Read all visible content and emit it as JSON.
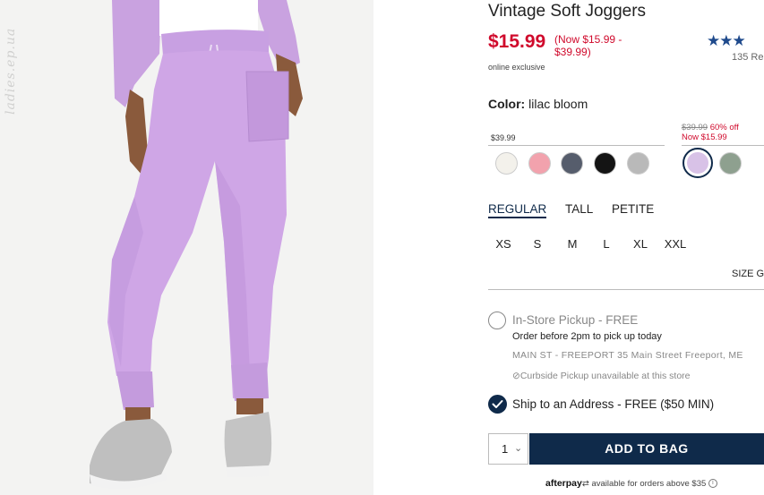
{
  "watermark": "ladies.ep.ua",
  "product": {
    "title": "Vintage Soft Joggers",
    "sale_price": "$15.99",
    "price_range": "(Now $15.99 - $39.99)",
    "exclusive": "online exclusive",
    "rating_value": 3.5,
    "stars": "★★★",
    "reviews": "135 Re"
  },
  "color": {
    "label": "Color:",
    "value": "lilac bloom",
    "regular_group_price": "$39.99",
    "sale_group_was": "$39.99",
    "sale_group_discount": "60% off",
    "sale_group_now": "Now $15.99",
    "swatches": [
      {
        "name": "ivory",
        "hex": "#f3f1eb"
      },
      {
        "name": "pink",
        "hex": "#f2a2ad"
      },
      {
        "name": "slate",
        "hex": "#565d6c"
      },
      {
        "name": "black",
        "hex": "#141414"
      },
      {
        "name": "heather-grey",
        "hex": "#b9b9b9"
      },
      {
        "name": "lilac-bloom",
        "hex": "#d8c2e7",
        "selected": true
      },
      {
        "name": "sage",
        "hex": "#8ea08f"
      }
    ]
  },
  "fit_tabs": [
    {
      "label": "REGULAR",
      "active": true
    },
    {
      "label": "TALL",
      "active": false
    },
    {
      "label": "PETITE",
      "active": false
    }
  ],
  "sizes": [
    "XS",
    "S",
    "M",
    "L",
    "XL",
    "XXL"
  ],
  "size_guide": "SIZE G",
  "fulfillment": {
    "pickup_label": "In-Store Pickup - FREE",
    "pickup_note": "Order before 2pm to pick up today",
    "store_address": "MAIN ST - FREEPORT 35 Main Street  Freeport, ME",
    "curbside": "Curbside Pickup unavailable at this store",
    "ship_label": "Ship to an Address - FREE ($50 MIN)"
  },
  "cart": {
    "quantity": "1",
    "add_button": "ADD TO BAG"
  },
  "afterpay": {
    "brand": "afterpay",
    "text": "available for orders above $35"
  },
  "colors": {
    "navy": "#0f2a4a",
    "sale_red": "#d00a2c",
    "pant_lilac": "#cfa6e6"
  }
}
